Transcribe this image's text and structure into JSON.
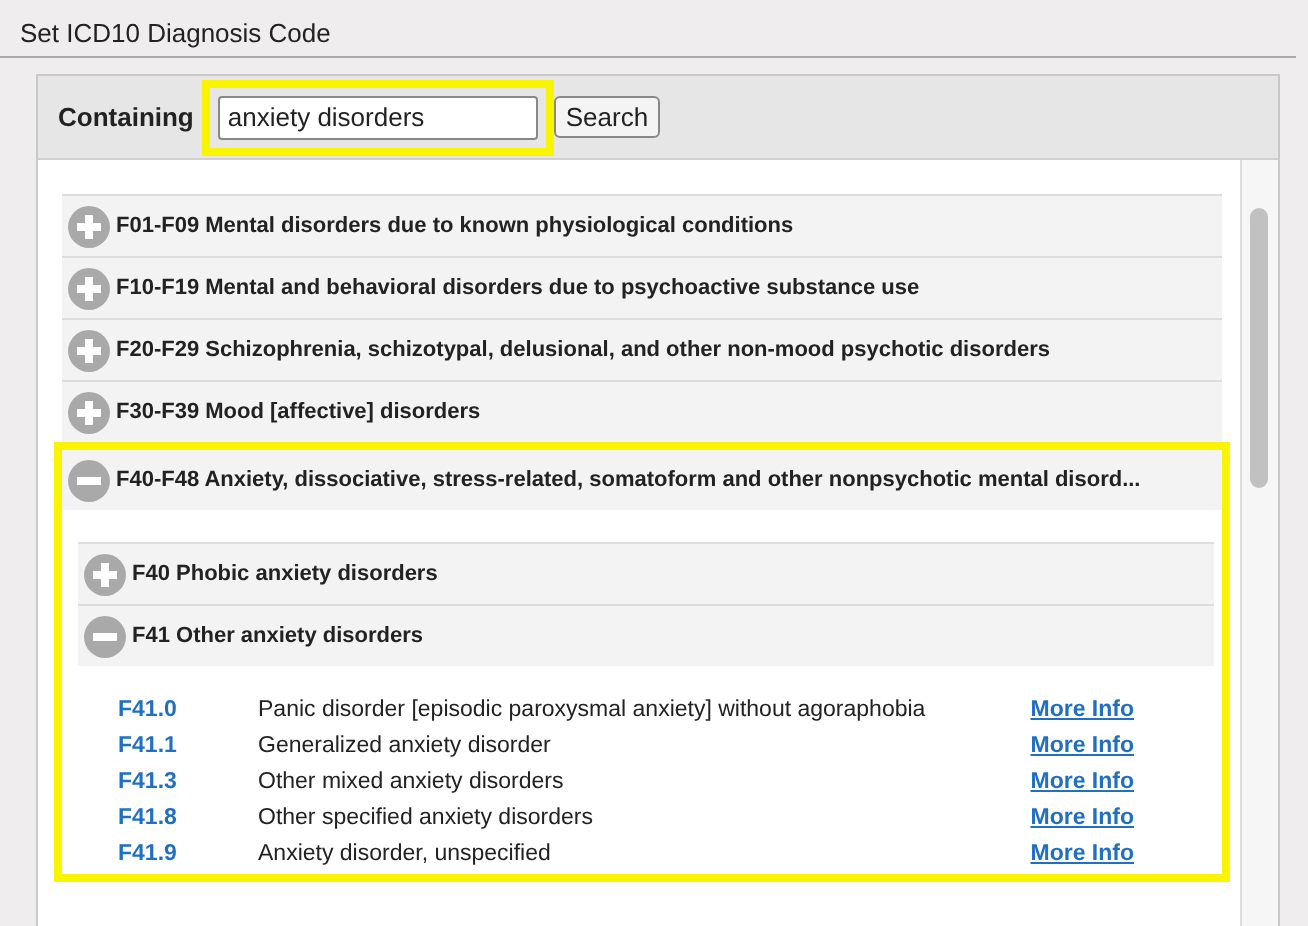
{
  "title": "Set ICD10 Diagnosis Code",
  "search": {
    "label": "Containing",
    "value": "anxiety disorders",
    "highlighted": true,
    "button": "Search"
  },
  "categories": [
    {
      "label": "F01-F09 Mental disorders due to known physiological conditions",
      "expanded": false
    },
    {
      "label": "F10-F19 Mental and behavioral disorders due to psychoactive substance use",
      "expanded": false
    },
    {
      "label": "F20-F29 Schizophrenia, schizotypal, delusional, and other non-mood psychotic disorders",
      "expanded": false
    },
    {
      "label": "F30-F39 Mood [affective] disorders",
      "expanded": false
    },
    {
      "label": "F40-F48 Anxiety, dissociative, stress-related, somatoform and other nonpsychotic mental disord...",
      "expanded": true,
      "highlighted": true,
      "children": [
        {
          "label": "F40 Phobic anxiety disorders",
          "expanded": false
        },
        {
          "label": "F41 Other anxiety disorders",
          "expanded": true,
          "codes": [
            {
              "code": "F41.0",
              "description": "Panic disorder [episodic paroxysmal anxiety] without agoraphobia",
              "link": "More Info"
            },
            {
              "code": "F41.1",
              "description": "Generalized anxiety disorder",
              "link": "More Info"
            },
            {
              "code": "F41.3",
              "description": "Other mixed anxiety disorders",
              "link": "More Info"
            },
            {
              "code": "F41.8",
              "description": "Other specified anxiety disorders",
              "link": "More Info"
            },
            {
              "code": "F41.9",
              "description": "Anxiety disorder, unspecified",
              "link": "More Info"
            }
          ]
        }
      ]
    }
  ]
}
